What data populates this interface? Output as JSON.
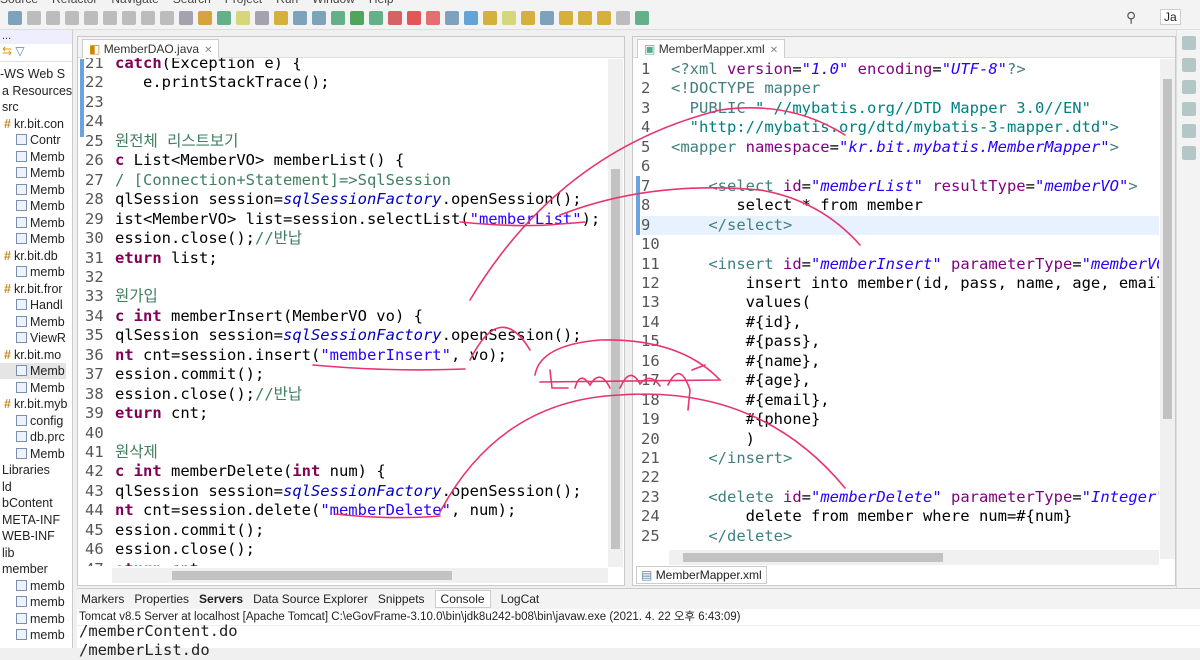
{
  "menu": [
    "Source",
    "Refactor",
    "Navigate",
    "Search",
    "Project",
    "Run",
    "Window",
    "Help"
  ],
  "perspective": "Ja",
  "tree": {
    "header": "...",
    "items": [
      {
        "label": "-WS Web S",
        "kind": "project"
      },
      {
        "label": "a Resources",
        "kind": "folder"
      },
      {
        "label": "src",
        "kind": "folder"
      },
      {
        "label": "kr.bit.con",
        "kind": "package"
      },
      {
        "label": "Contr",
        "kind": "file"
      },
      {
        "label": "Memb",
        "kind": "file"
      },
      {
        "label": "Memb",
        "kind": "file"
      },
      {
        "label": "Memb",
        "kind": "file"
      },
      {
        "label": "Memb",
        "kind": "file"
      },
      {
        "label": "Memb",
        "kind": "file"
      },
      {
        "label": "Memb",
        "kind": "file"
      },
      {
        "label": "kr.bit.db",
        "kind": "package"
      },
      {
        "label": "memb",
        "kind": "file"
      },
      {
        "label": "kr.bit.fror",
        "kind": "package"
      },
      {
        "label": "Handl",
        "kind": "file"
      },
      {
        "label": "Memb",
        "kind": "file"
      },
      {
        "label": "ViewR",
        "kind": "file"
      },
      {
        "label": "kr.bit.mo",
        "kind": "package"
      },
      {
        "label": "Memb",
        "kind": "file",
        "selected": true
      },
      {
        "label": "Memb",
        "kind": "file"
      },
      {
        "label": "kr.bit.myb",
        "kind": "package"
      },
      {
        "label": "config",
        "kind": "file"
      },
      {
        "label": "db.prc",
        "kind": "file"
      },
      {
        "label": "Memb",
        "kind": "file"
      },
      {
        "label": "Libraries",
        "kind": "folder"
      },
      {
        "label": "ld",
        "kind": "folder"
      },
      {
        "label": "bContent",
        "kind": "folder"
      },
      {
        "label": "META-INF",
        "kind": "folder"
      },
      {
        "label": "WEB-INF",
        "kind": "folder"
      },
      {
        "label": "lib",
        "kind": "folder"
      },
      {
        "label": "member",
        "kind": "folder"
      },
      {
        "label": "memb",
        "kind": "file"
      },
      {
        "label": "memb",
        "kind": "file"
      },
      {
        "label": "memb",
        "kind": "file"
      },
      {
        "label": "memb",
        "kind": "file"
      }
    ]
  },
  "java_editor": {
    "tab": "MemberDAO.java",
    "first_line": 21,
    "lines": [
      [
        [
          "catch",
          "k"
        ],
        [
          "(Exception e) {",
          "p"
        ]
      ],
      [
        [
          "   e.printStackTrace();",
          "p"
        ]
      ],
      [],
      [],
      [
        [
          "원전체 리스트보기",
          "c"
        ]
      ],
      [
        [
          "c ",
          "k"
        ],
        [
          "List<MemberVO> memberList() {",
          "p"
        ]
      ],
      [
        [
          "/ [Connection+Statement]=>SqlSession",
          "c"
        ]
      ],
      [
        [
          "qlSession session=",
          "p"
        ],
        [
          "sqlSessionFactory",
          "f"
        ],
        [
          ".openSession();",
          "p"
        ]
      ],
      [
        [
          "ist<MemberVO> list=session.selectList(",
          "p"
        ],
        [
          "\"memberList\"",
          "s"
        ],
        [
          ");",
          "p"
        ]
      ],
      [
        [
          "ession.close();",
          "p"
        ],
        [
          "//반납",
          "c"
        ]
      ],
      [
        [
          "eturn",
          "k"
        ],
        [
          " list;",
          "p"
        ]
      ],
      [],
      [
        [
          "원가입",
          "c"
        ]
      ],
      [
        [
          "c ",
          "k"
        ],
        [
          "int",
          "k"
        ],
        [
          " memberInsert(MemberVO vo) {",
          "p"
        ]
      ],
      [
        [
          "qlSession session=",
          "p"
        ],
        [
          "sqlSessionFactory",
          "f"
        ],
        [
          ".openSession();",
          "p"
        ]
      ],
      [
        [
          "nt",
          "k"
        ],
        [
          " cnt=session.insert(",
          "p"
        ],
        [
          "\"memberInsert\"",
          "s"
        ],
        [
          ", vo);",
          "p"
        ]
      ],
      [
        [
          "ession.commit();",
          "p"
        ]
      ],
      [
        [
          "ession.close();",
          "p"
        ],
        [
          "//반납",
          "c"
        ]
      ],
      [
        [
          "eturn",
          "k"
        ],
        [
          " cnt;",
          "p"
        ]
      ],
      [],
      [
        [
          "원삭제",
          "c"
        ]
      ],
      [
        [
          "c ",
          "k"
        ],
        [
          "int",
          "k"
        ],
        [
          " memberDelete(",
          "p"
        ],
        [
          "int",
          "k"
        ],
        [
          " num) {",
          "p"
        ]
      ],
      [
        [
          "qlSession session=",
          "p"
        ],
        [
          "sqlSessionFactory",
          "f"
        ],
        [
          ".openSession();",
          "p"
        ]
      ],
      [
        [
          "nt",
          "k"
        ],
        [
          " cnt=session.delete(",
          "p"
        ],
        [
          "\"memberDelete\"",
          "s"
        ],
        [
          ", num);",
          "p"
        ]
      ],
      [
        [
          "ession.commit();",
          "p"
        ]
      ],
      [
        [
          "ession.close();",
          "p"
        ]
      ],
      [
        [
          "eturn",
          "k"
        ],
        [
          " cnt;",
          "p"
        ]
      ]
    ]
  },
  "xml_editor": {
    "tab": "MemberMapper.xml",
    "bottom_tab": "MemberMapper.xml",
    "first_line": 1,
    "highlight_line": 9,
    "lines": [
      [
        [
          "<?xml ",
          "tg"
        ],
        [
          "version",
          "a"
        ],
        [
          "=",
          "p"
        ],
        [
          "\"1.0\"",
          "v"
        ],
        [
          " encoding",
          "a"
        ],
        [
          "=",
          "p"
        ],
        [
          "\"UTF-8\"",
          "v"
        ],
        [
          "?>",
          "tg"
        ]
      ],
      [
        [
          "<!DOCTYPE mapper",
          "tg"
        ]
      ],
      [
        [
          "  PUBLIC ",
          "tg"
        ],
        [
          "\"-//mybatis.org//DTD Mapper 3.0//EN\"",
          "d"
        ]
      ],
      [
        [
          "  \"http://mybatis.org/dtd/mybatis-3-mapper.dtd\"",
          "d"
        ],
        [
          ">",
          "tg"
        ]
      ],
      [
        [
          "<mapper ",
          "tg"
        ],
        [
          "namespace",
          "a"
        ],
        [
          "=",
          "p"
        ],
        [
          "\"kr.bit.mybatis.MemberMapper\"",
          "v"
        ],
        [
          ">",
          "tg"
        ]
      ],
      [],
      [
        [
          "    <select ",
          "tg"
        ],
        [
          "id",
          "a"
        ],
        [
          "=",
          "p"
        ],
        [
          "\"memberList\"",
          "v"
        ],
        [
          " resultType",
          "a"
        ],
        [
          "=",
          "p"
        ],
        [
          "\"memberVO\"",
          "v"
        ],
        [
          ">",
          "tg"
        ]
      ],
      [
        [
          "       select * from member",
          "p"
        ]
      ],
      [
        [
          "    </select>",
          "tg"
        ]
      ],
      [],
      [
        [
          "    <insert ",
          "tg"
        ],
        [
          "id",
          "a"
        ],
        [
          "=",
          "p"
        ],
        [
          "\"memberInsert\"",
          "v"
        ],
        [
          " parameterType",
          "a"
        ],
        [
          "=",
          "p"
        ],
        [
          "\"memberVO\"",
          "v"
        ],
        [
          ">",
          "tg"
        ]
      ],
      [
        [
          "        insert into member(id, pass, name, age, email, phone)",
          "p"
        ]
      ],
      [
        [
          "        values(",
          "p"
        ]
      ],
      [
        [
          "        #{id},",
          "p"
        ]
      ],
      [
        [
          "        #{pass},",
          "p"
        ]
      ],
      [
        [
          "        #{name},",
          "p"
        ]
      ],
      [
        [
          "        #{age},",
          "p"
        ]
      ],
      [
        [
          "        #{email},",
          "p"
        ]
      ],
      [
        [
          "        #{phone}",
          "p"
        ]
      ],
      [
        [
          "        )",
          "p"
        ]
      ],
      [
        [
          "    </insert>",
          "tg"
        ]
      ],
      [],
      [
        [
          "    <delete ",
          "tg"
        ],
        [
          "id",
          "a"
        ],
        [
          "=",
          "p"
        ],
        [
          "\"memberDelete\"",
          "v"
        ],
        [
          " parameterType",
          "a"
        ],
        [
          "=",
          "p"
        ],
        [
          "\"Integer\"",
          "v"
        ],
        [
          ">",
          "tg"
        ]
      ],
      [
        [
          "        delete from member where num=#{num}",
          "p"
        ]
      ],
      [
        [
          "    </delete>",
          "tg"
        ]
      ]
    ]
  },
  "bottom": {
    "tabs": [
      "Markers",
      "Properties",
      "Servers",
      "Data Source Explorer",
      "Snippets",
      "Console",
      "LogCat"
    ],
    "active_tab": "Console",
    "status": "Tomcat v8.5 Server at localhost [Apache Tomcat] C:\\eGovFrame-3.10.0\\bin\\jdk8u242-b08\\bin\\javaw.exe  (2021. 4. 22 오후 6:43:09)",
    "output": [
      "/memberContent.do",
      "/memberList.do"
    ]
  },
  "annotation_color": "#e8336f",
  "handwriting": "mapping"
}
